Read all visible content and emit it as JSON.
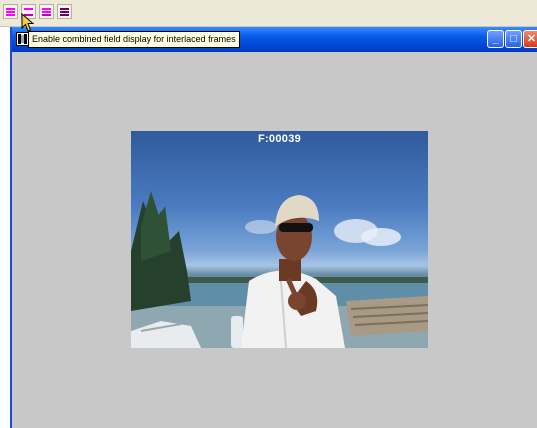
{
  "toolbar": {
    "buttons": [
      {
        "icon": "field-display-combined-icon"
      },
      {
        "icon": "field-display-top-icon"
      },
      {
        "icon": "field-display-bottom-icon"
      },
      {
        "icon": "field-display-separate-icon"
      }
    ]
  },
  "tooltip": {
    "text": "Enable combined field display for interlaced frames"
  },
  "window": {
    "controls": [
      "minimize",
      "maximize",
      "close"
    ],
    "video": {
      "frame_counter": "F:00039"
    }
  },
  "colors": {
    "toolbar_bg": "#ece9d8",
    "titlebar": "#0047d8",
    "workspace_bg": "#c8c8c8",
    "tooltip_bg": "#ffffe1",
    "icon_magenta": "#c000c0"
  }
}
